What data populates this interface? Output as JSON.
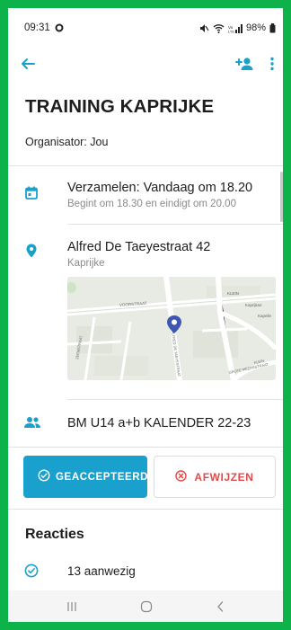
{
  "status_bar": {
    "time": "09:31",
    "battery": "98%",
    "signal_text": "Vo LTE"
  },
  "app_bar": {
    "back_icon": "arrow-left-icon",
    "add_person_icon": "person-add-icon",
    "menu_icon": "more-vert-icon"
  },
  "event": {
    "title": "TRAINING KAPRIJKE",
    "organizer": "Organisator: Jou",
    "gather_main": "Verzamelen: Vandaag om 18.20",
    "gather_sub": "Begint om 18.30 en eindigt om 20.00",
    "address_main": "Alfred De Taeyestraat 42",
    "address_sub": "Kaprijke",
    "calendar_name": "BM U14 a+b KALENDER 22-23"
  },
  "map": {
    "street_labels": [
      "VOORSTRAAT",
      "KLEIN",
      "Kaprijkse",
      "Kapelle",
      "ALFRED DE TAEYESTRAAT",
      "ZEEMSTRAAT",
      "GROTE MEERSSTRAAT",
      "KLEIN"
    ]
  },
  "actions": {
    "accept_label": "GEACCEPTEERD",
    "reject_label": "AFWIJZEN"
  },
  "reactions": {
    "title": "Reacties",
    "present": "13 aanwezig"
  },
  "colors": {
    "accent": "#1aa0cc",
    "reject": "#e04a4a",
    "frame": "#0db24a"
  }
}
